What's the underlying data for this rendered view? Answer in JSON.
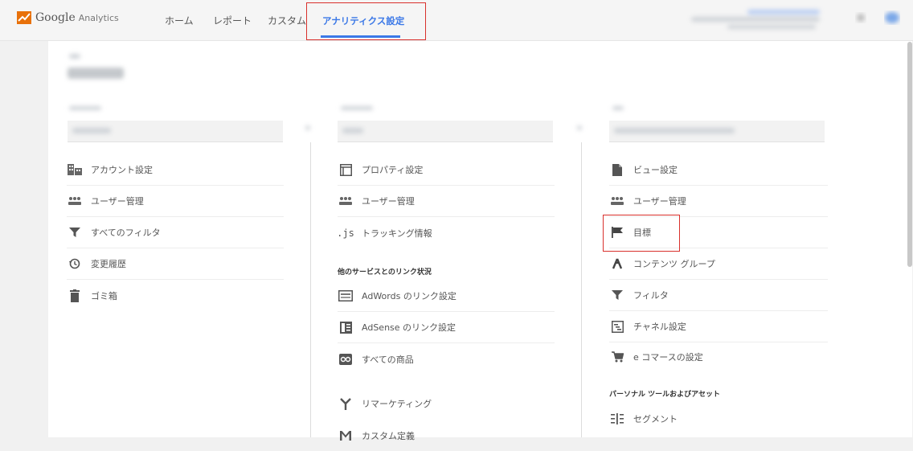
{
  "brand": {
    "google": "Google",
    "analytics": "Analytics",
    "color": "#e8710a"
  },
  "nav": {
    "home": "ホーム",
    "report": "レポート",
    "custom": "カスタム",
    "admin": "アナリティクス設定"
  },
  "account_column": {
    "items": [
      {
        "label": "アカウント設定",
        "icon": "account-icon"
      },
      {
        "label": "ユーザー管理",
        "icon": "users-icon"
      },
      {
        "label": "すべてのフィルタ",
        "icon": "filter-icon"
      },
      {
        "label": "変更履歴",
        "icon": "history-icon"
      },
      {
        "label": "ゴミ箱",
        "icon": "trash-icon"
      }
    ]
  },
  "property_column": {
    "items": [
      {
        "label": "プロパティ設定",
        "icon": "property-icon"
      },
      {
        "label": "ユーザー管理",
        "icon": "users-icon"
      },
      {
        "label": "トラッキング情報",
        "icon": "js-icon"
      }
    ],
    "js_glyph": ".js",
    "section_title": "他のサービスとのリンク状況",
    "link_items": [
      {
        "label": "AdWords のリンク設定",
        "icon": "adwords-icon"
      },
      {
        "label": "AdSense のリンク設定",
        "icon": "adsense-icon"
      },
      {
        "label": "すべての商品",
        "icon": "products-icon"
      },
      {
        "label": "リマーケティング",
        "icon": "remarketing-icon"
      },
      {
        "label": "カスタム定義",
        "icon": "custom-definition-icon"
      }
    ]
  },
  "view_column": {
    "items": [
      {
        "label": "ビュー設定",
        "icon": "document-icon"
      },
      {
        "label": "ユーザー管理",
        "icon": "users-icon"
      },
      {
        "label": "目標",
        "icon": "flag-icon"
      },
      {
        "label": "コンテンツ グループ",
        "icon": "content-group-icon"
      },
      {
        "label": "フィルタ",
        "icon": "filter-icon"
      },
      {
        "label": "チャネル設定",
        "icon": "channel-icon"
      },
      {
        "label": "e コマースの設定",
        "icon": "cart-icon"
      }
    ],
    "section_title": "パーソナル ツールおよびアセット",
    "tools_items": [
      {
        "label": "セグメント",
        "icon": "segment-icon"
      }
    ]
  },
  "colors": {
    "accent": "#3b78e7",
    "highlight": "#d9302c",
    "icon": "#5f6368"
  }
}
